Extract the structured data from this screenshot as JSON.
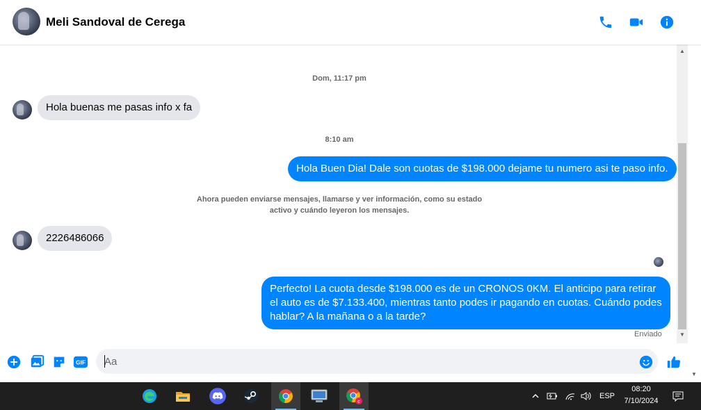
{
  "header": {
    "contact_name": "Meli Sandoval de Cerega",
    "icons": [
      "phone-icon",
      "video-icon",
      "info-icon"
    ],
    "accent_color": "#0084ff"
  },
  "conversation": {
    "timestamp_1": "Dom, 11:17 pm",
    "msg_in_1": "Hola buenas me pasas info x fa",
    "timestamp_2": "8:10 am",
    "msg_out_1": "Hola Buen Dia! Dale son cuotas de $198.000 dejame tu numero asi te paso info.",
    "notice": "Ahora pueden enviarse mensajes, llamarse y ver información, como su estado activo y cuándo leyeron los mensajes.",
    "msg_in_2": "2226486066",
    "msg_out_2": "Perfecto! La cuota desde $198.000 es de un CRONOS 0KM. El anticipo para retirar el auto es de $7.133.400, mientras tanto podes ir pagando en cuotas. Cuándo podes hablar? A la mañana o a la tarde?",
    "status": "Enviado"
  },
  "composer": {
    "placeholder": "Aa",
    "icons": [
      "plus-icon",
      "image-icon",
      "sticker-icon",
      "gif-icon",
      "emoji-icon",
      "like-icon"
    ],
    "gif_label": "GIF"
  },
  "taskbar": {
    "apps": [
      "edge-icon",
      "file-explorer-icon",
      "discord-icon",
      "steam-icon",
      "chrome-icon",
      "network-app-icon",
      "chrome-profile-icon"
    ],
    "language": "ESP",
    "time": "08:20",
    "date": "7/10/2024"
  }
}
